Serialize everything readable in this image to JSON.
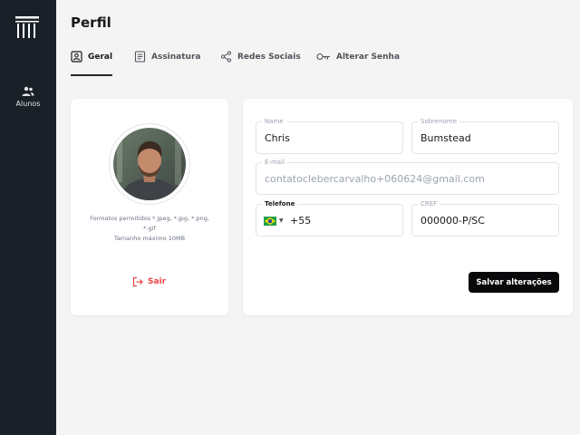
{
  "sidebar": {
    "logo_icon": "columns-logo-icon",
    "items": [
      {
        "label": "Alunos",
        "icon": "users-icon"
      }
    ]
  },
  "header": {
    "title": "Perfil"
  },
  "tabs": [
    {
      "label": "Geral",
      "icon": "profile-card-icon",
      "active": true
    },
    {
      "label": "Assinatura",
      "icon": "document-icon",
      "active": false
    },
    {
      "label": "Redes Sociais",
      "icon": "share-icon",
      "active": false
    },
    {
      "label": "Alterar Senha",
      "icon": "key-icon",
      "active": false
    }
  ],
  "profile": {
    "hint_line1": "Formatos permitidos *.jpeg, *.jpg, *.png, *.gif",
    "hint_line2": "Tamanho máximo 10MB",
    "logout_label": "Sair"
  },
  "form": {
    "name": {
      "label": "Name",
      "value": "Chris"
    },
    "surname": {
      "label": "Sobrenome",
      "value": "Bumstead"
    },
    "email": {
      "label": "E-mail",
      "value": "contatoclebercarvalho+060624@gmail.com"
    },
    "phone": {
      "label": "Telefone",
      "value": "+55",
      "country": "Brazil"
    },
    "cref": {
      "label": "CREF",
      "value": "000000-P/SC"
    },
    "save_label": "Salvar alterações"
  },
  "colors": {
    "sidebar_bg": "#1a2028",
    "accent_danger": "#ef4444",
    "button_bg": "#09090b"
  }
}
